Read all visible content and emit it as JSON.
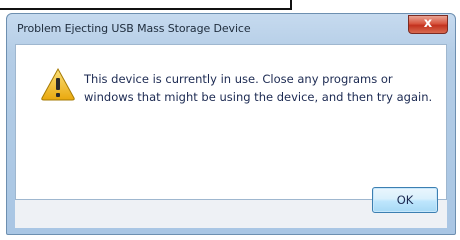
{
  "dialog": {
    "title": "Problem Ejecting USB Mass Storage Device",
    "close_glyph": "x",
    "message": "This device is currently in use. Close any programs or windows that might be using the device, and then try again.",
    "icon": "warning-icon",
    "ok_label": "OK"
  },
  "colors": {
    "title_bar": "#b4cde6",
    "close_button": "#c3321f",
    "warning": "#f1c232",
    "ok_button": "#bee6fd"
  }
}
